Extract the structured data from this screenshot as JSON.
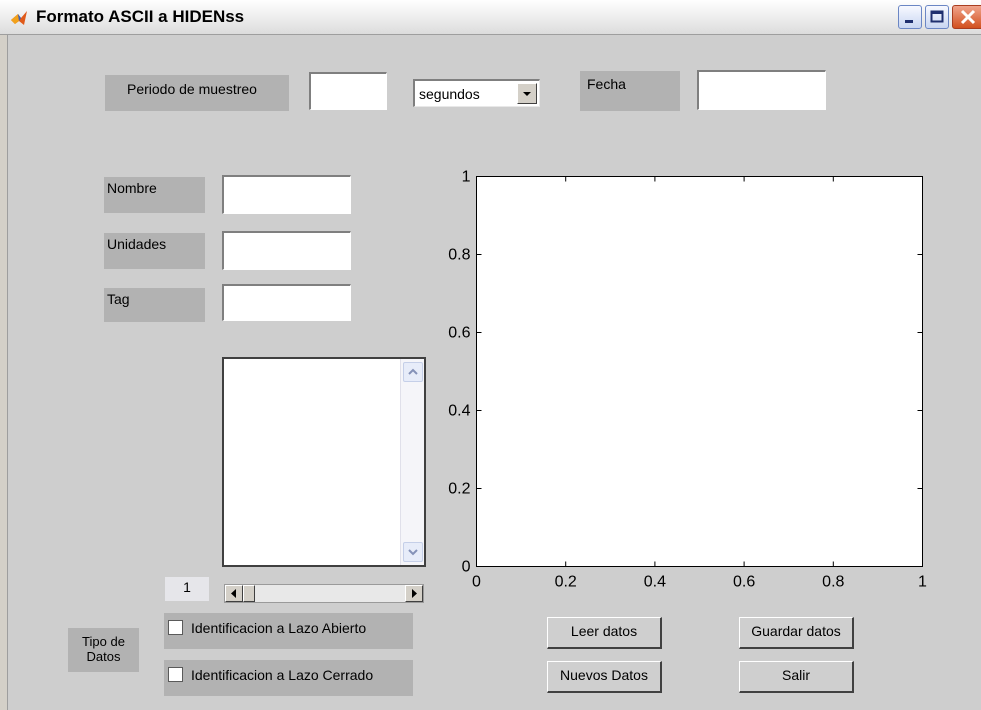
{
  "window": {
    "title": "Formato ASCII a HIDENss",
    "icon": "matlab-logo-icon",
    "controls": [
      "minimize-icon",
      "maximize-icon",
      "close-icon"
    ]
  },
  "top": {
    "periodo_label": "Periodo de muestreo",
    "periodo_value": "",
    "units_selected": "segundos",
    "fecha_label": "Fecha",
    "fecha_value": ""
  },
  "fields": {
    "nombre_label": "Nombre",
    "nombre_value": "",
    "unidades_label": "Unidades",
    "unidades_value": "",
    "tag_label": "Tag",
    "tag_value": ""
  },
  "listbox": {
    "items": []
  },
  "slider": {
    "index_text": "1",
    "position": 0.0
  },
  "tipo": {
    "label": "Tipo de\nDatos",
    "open_loop_label": "Identificacion a Lazo Abierto",
    "open_loop_checked": false,
    "closed_loop_label": "Identificacion a Lazo Cerrado",
    "closed_loop_checked": false
  },
  "buttons": {
    "leer": "Leer datos",
    "guardar": "Guardar datos",
    "nuevos": "Nuevos Datos",
    "salir": "Salir"
  },
  "chart_data": {
    "type": "line",
    "title": "",
    "xlabel": "",
    "ylabel": "",
    "series": [],
    "xlim": [
      0,
      1
    ],
    "ylim": [
      0,
      1
    ],
    "xticks": [
      0,
      0.2,
      0.4,
      0.6,
      0.8,
      1
    ],
    "xtick_labels": [
      "0",
      "0.2",
      "0.4",
      "0.6",
      "0.8",
      "1"
    ],
    "yticks": [
      0,
      0.2,
      0.4,
      0.6,
      0.8,
      1
    ],
    "ytick_labels": [
      "0",
      "0.2",
      "0.4",
      "0.6",
      "0.8",
      "1"
    ],
    "grid": false
  },
  "colors": {
    "figure_bg": "#cecece",
    "label_bg": "#b2b2b2",
    "axes_bg": "#ffffff"
  }
}
